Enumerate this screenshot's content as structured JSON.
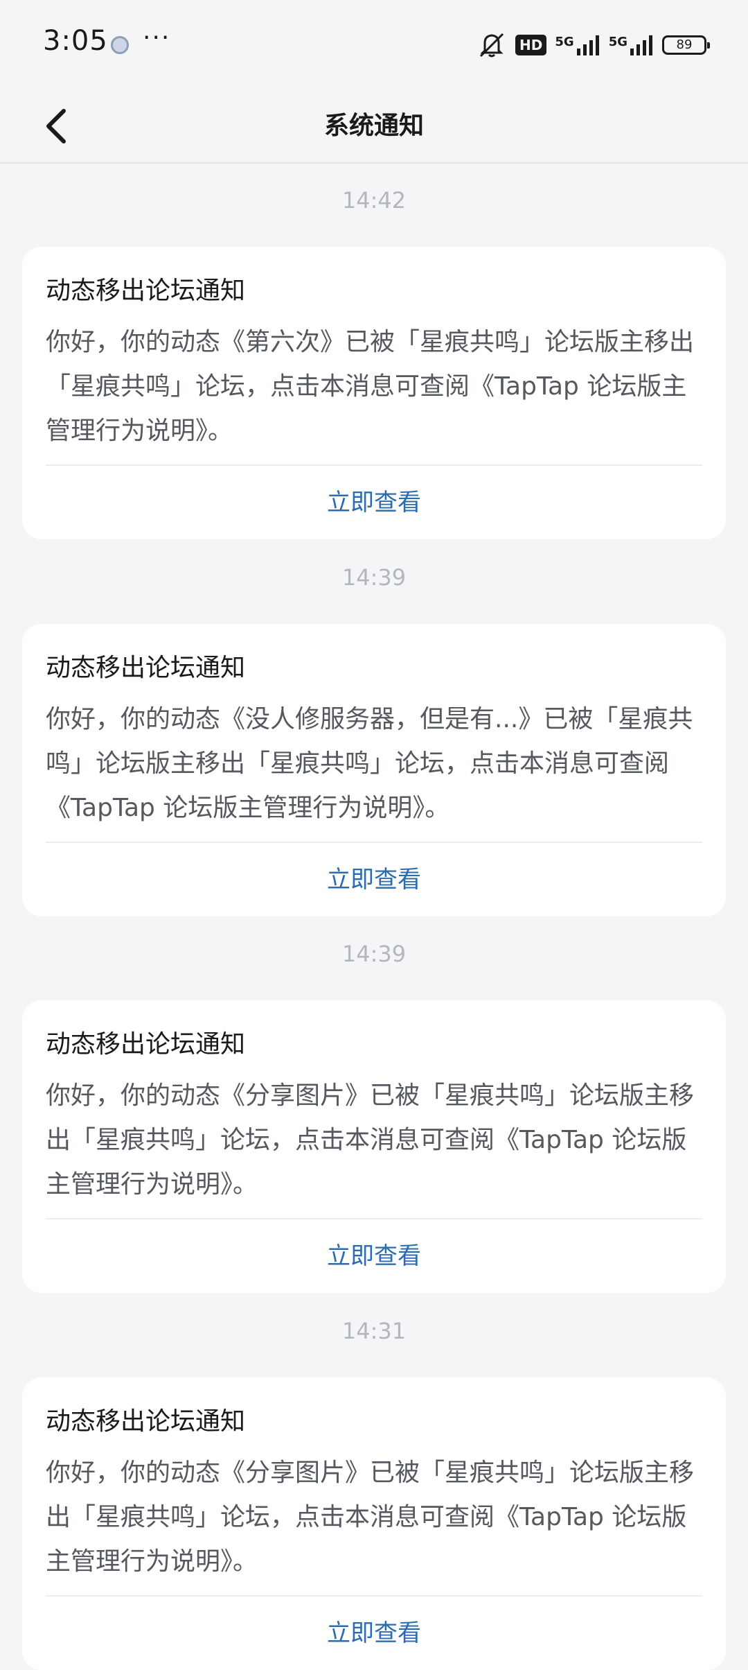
{
  "status_bar": {
    "time": "3:05",
    "more": "···",
    "hd": "HD",
    "network_1": "5G",
    "network_2": "5G",
    "battery": "89"
  },
  "nav": {
    "title": "系统通知"
  },
  "messages": [
    {
      "time": "14:42",
      "title": "动态移出论坛通知",
      "body": "你好，你的动态《第六次》已被「星痕共鸣」论坛版主移出「星痕共鸣」论坛，点击本消息可查阅《TapTap 论坛版主管理行为说明》。",
      "action": "立即查看"
    },
    {
      "time": "14:39",
      "title": "动态移出论坛通知",
      "body": "你好，你的动态《没人修服务器，但是有...》已被「星痕共鸣」论坛版主移出「星痕共鸣」论坛，点击本消息可查阅《TapTap 论坛版主管理行为说明》。",
      "action": "立即查看"
    },
    {
      "time": "14:39",
      "title": "动态移出论坛通知",
      "body": "你好，你的动态《分享图片》已被「星痕共鸣」论坛版主移出「星痕共鸣」论坛，点击本消息可查阅《TapTap 论坛版主管理行为说明》。",
      "action": "立即查看"
    },
    {
      "time": "14:31",
      "title": "动态移出论坛通知",
      "body": "你好，你的动态《分享图片》已被「星痕共鸣」论坛版主移出「星痕共鸣」论坛，点击本消息可查阅《TapTap 论坛版主管理行为说明》。",
      "action": "立即查看"
    }
  ],
  "colors": {
    "background": "#f4f5f7",
    "card": "#ffffff",
    "link": "#2b6cb0",
    "timestamp": "#b3b6bc"
  }
}
